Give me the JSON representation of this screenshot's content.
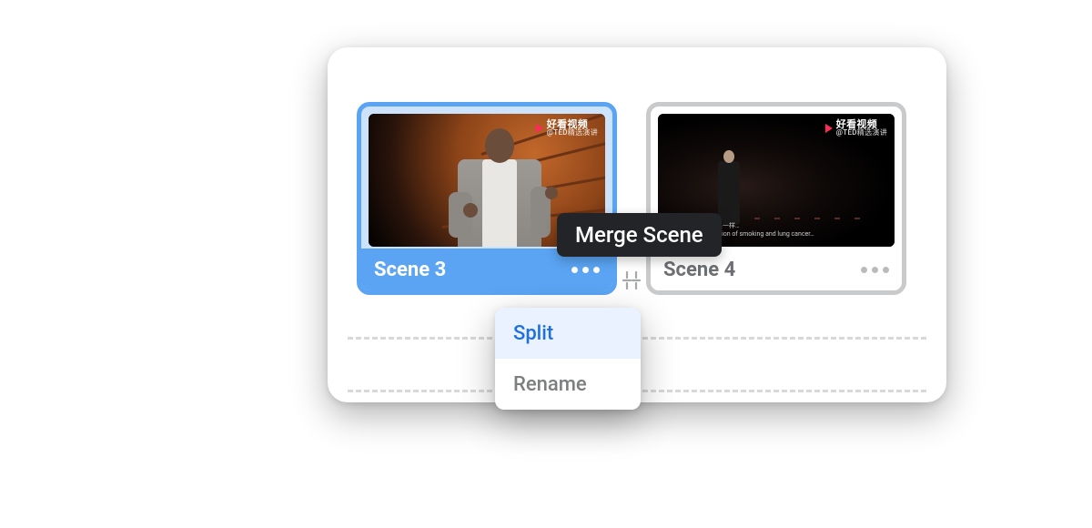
{
  "scenes": [
    {
      "label": "Scene 3",
      "selected": true,
      "thumb_logo_top": "好看视频",
      "thumb_logo_bot": "@TED精选演讲"
    },
    {
      "label": "Scene 4",
      "selected": false,
      "thumb_logo_top": "好看视频",
      "thumb_logo_bot": "@TED精选演讲",
      "subtitle_cn": "吸烟导致肺癌的关系一样…",
      "subtitle_en": "as with the association of smoking and lung cancer…"
    }
  ],
  "tooltip": {
    "merge_label": "Merge Scene"
  },
  "menu": {
    "items": [
      {
        "label": "Split",
        "hover": true
      },
      {
        "label": "Rename",
        "hover": false
      }
    ]
  }
}
